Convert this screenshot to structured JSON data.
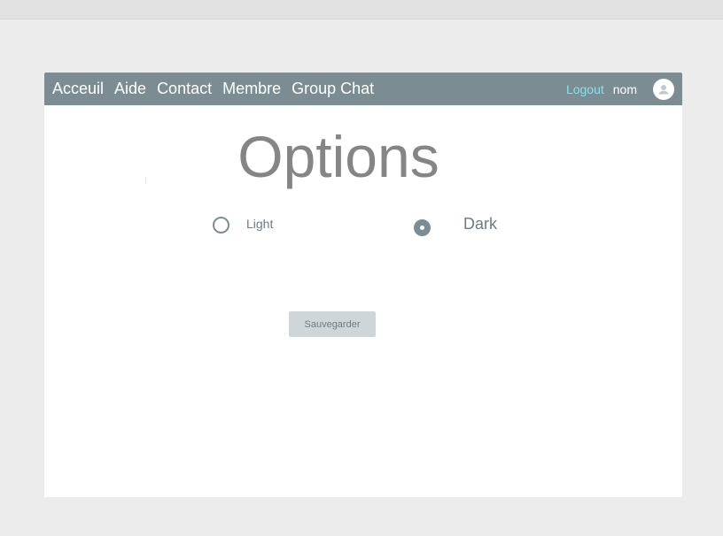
{
  "nav": {
    "links": [
      "Acceuil",
      "Aide",
      "Contact",
      "Membre",
      "Group Chat"
    ],
    "logout_label": "Logout",
    "username": "nom",
    "avatar_icon": "user-icon"
  },
  "main": {
    "title": "Options",
    "theme_options": {
      "light_label": "Light",
      "dark_label": "Dark",
      "selected": "Dark"
    },
    "save_label": "Sauvegarder"
  },
  "colors": {
    "navbar": "#7b8d92",
    "logout": "#7fe3ef",
    "title": "#858585",
    "button_bg": "#cfd6da",
    "page_bg": "#ececec"
  }
}
